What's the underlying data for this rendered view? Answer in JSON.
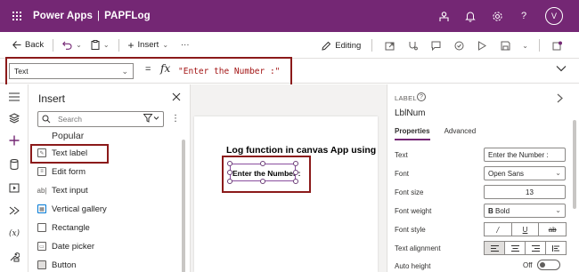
{
  "app": {
    "title": "Power Apps",
    "separator": "|",
    "app_name": "PAPFLog",
    "avatar_initial": "V"
  },
  "appbar_icons": [
    "environment-icon",
    "bell-icon",
    "gear-icon",
    "help-icon"
  ],
  "cmdbar": {
    "back_label": "Back",
    "insert_label": "Insert",
    "more_label": "···",
    "editing_label": "Editing"
  },
  "formula": {
    "property": "Text",
    "equals": "=",
    "fx": "fx",
    "value": "\"Enter the Number :\""
  },
  "insert": {
    "title": "Insert",
    "search_placeholder": "Search",
    "section": "Popular",
    "items": [
      {
        "label": "Text label",
        "icon": "text-label-icon"
      },
      {
        "label": "Edit form",
        "icon": "edit-form-icon"
      },
      {
        "label": "Text input",
        "icon": "text-input-icon"
      },
      {
        "label": "Vertical gallery",
        "icon": "gallery-icon"
      },
      {
        "label": "Rectangle",
        "icon": "rectangle-icon"
      },
      {
        "label": "Date picker",
        "icon": "date-picker-icon"
      },
      {
        "label": "Button",
        "icon": "button-icon"
      }
    ]
  },
  "canvas": {
    "heading": "Log function in canvas App using P",
    "label_text": "Enter the Number :"
  },
  "props": {
    "type": "LABEL",
    "name": "LblNum",
    "tabs": [
      "Properties",
      "Advanced"
    ],
    "text_label": "Text",
    "text_value": "Enter the Number :",
    "font_label": "Font",
    "font_value": "Open Sans",
    "size_label": "Font size",
    "size_value": "13",
    "weight_label": "Font weight",
    "weight_value": "Bold",
    "style_label": "Font style",
    "align_label": "Text alignment",
    "autoh_label": "Auto height",
    "autoh_value": "Off"
  },
  "colors": {
    "brand": "#742774",
    "formula_string": "#a31515",
    "highlight_box": "#8b1a1a"
  }
}
